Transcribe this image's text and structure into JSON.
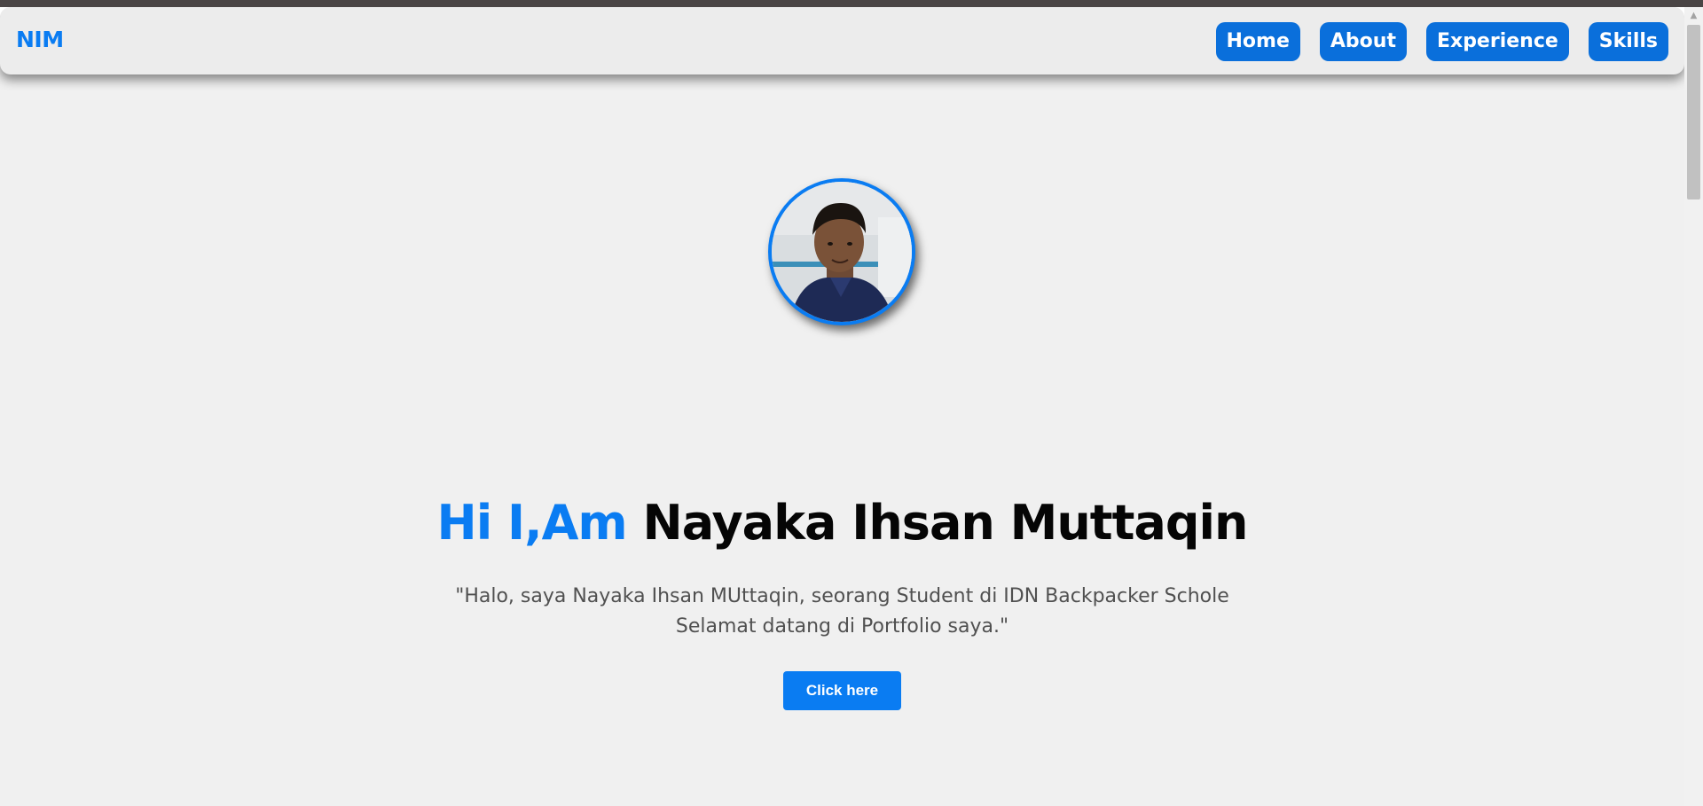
{
  "navbar": {
    "brand": "NIM",
    "links": [
      {
        "label": "Home"
      },
      {
        "label": "About"
      },
      {
        "label": "Experience"
      },
      {
        "label": "Skills"
      }
    ]
  },
  "hero": {
    "greeting": "Hi I,Am",
    "name": "Nayaka Ihsan Muttaqin",
    "description_line1": "\"Halo, saya Nayaka Ihsan MUttaqin, seorang Student di IDN Backpacker Schole",
    "description_line2": "Selamat datang di Portfolio saya.\"",
    "cta_label": "Click here"
  },
  "colors": {
    "accent": "#0a7cf2",
    "nav_button": "#0a6fdb",
    "page_background": "#f0f0f0",
    "heading_text": "#050505",
    "body_text": "#505050"
  },
  "icons": {
    "avatar": "profile-photo",
    "scroll_up": "triangle-up-icon"
  }
}
